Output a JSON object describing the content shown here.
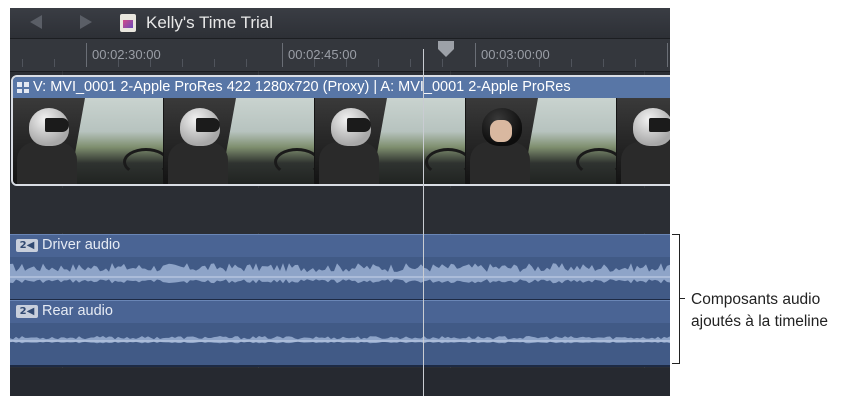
{
  "titlebar": {
    "project_title": "Kelly's Time Trial",
    "back_icon": "chevron-left-icon",
    "forward_icon": "chevron-right-icon",
    "project_icon": "project-icon"
  },
  "ruler": {
    "timecodes": [
      "00:02:30:00",
      "00:02:45:00",
      "00:03:00:00"
    ]
  },
  "clip": {
    "label": "V: MVI_0001 2-Apple ProRes 422 1280x720 (Proxy)  | A: MVI_0001 2-Apple ProRes"
  },
  "audio_components": [
    {
      "badge": "2",
      "name": "Driver audio"
    },
    {
      "badge": "2",
      "name": "Rear audio"
    }
  ],
  "callout": {
    "line1": "Composants audio",
    "line2": "ajoutés à la timeline"
  },
  "colors": {
    "timeline_bg": "#2b2e34",
    "clip_header": "#5876a6",
    "audio_bg": "#415a86",
    "waveform": "#8ea4c8"
  }
}
